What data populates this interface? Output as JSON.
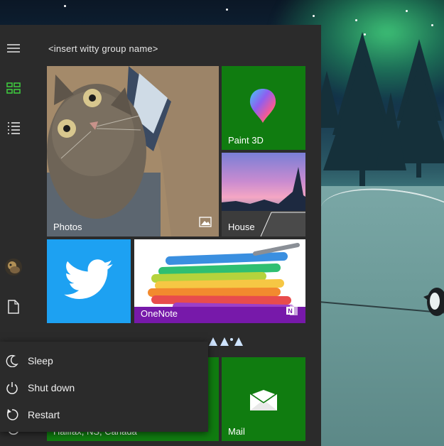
{
  "start_menu": {
    "group_title": "<insert witty group name>",
    "tiles": {
      "photos": "Photos",
      "paint3d": "Paint 3D",
      "house": "House",
      "twitter": "",
      "onenote": "OneNote",
      "weather": "Halifax, NS, Canada",
      "mail": "Mail"
    },
    "rail_icons": [
      "hamburger-menu-icon",
      "all-tiles-icon",
      "all-apps-list-icon",
      "user-avatar",
      "documents-icon",
      "power-icon"
    ],
    "power_menu": [
      {
        "label": "Sleep",
        "icon": "sleep-moon-icon"
      },
      {
        "label": "Shut down",
        "icon": "shutdown-icon"
      },
      {
        "label": "Restart",
        "icon": "restart-icon"
      }
    ]
  },
  "colors": {
    "menu_bg": "#2b2b2b",
    "tile_green": "#107c10",
    "twitter_blue": "#1da1f2",
    "onenote_purple": "#7719aa",
    "accent_icon": "#3ec63e"
  }
}
